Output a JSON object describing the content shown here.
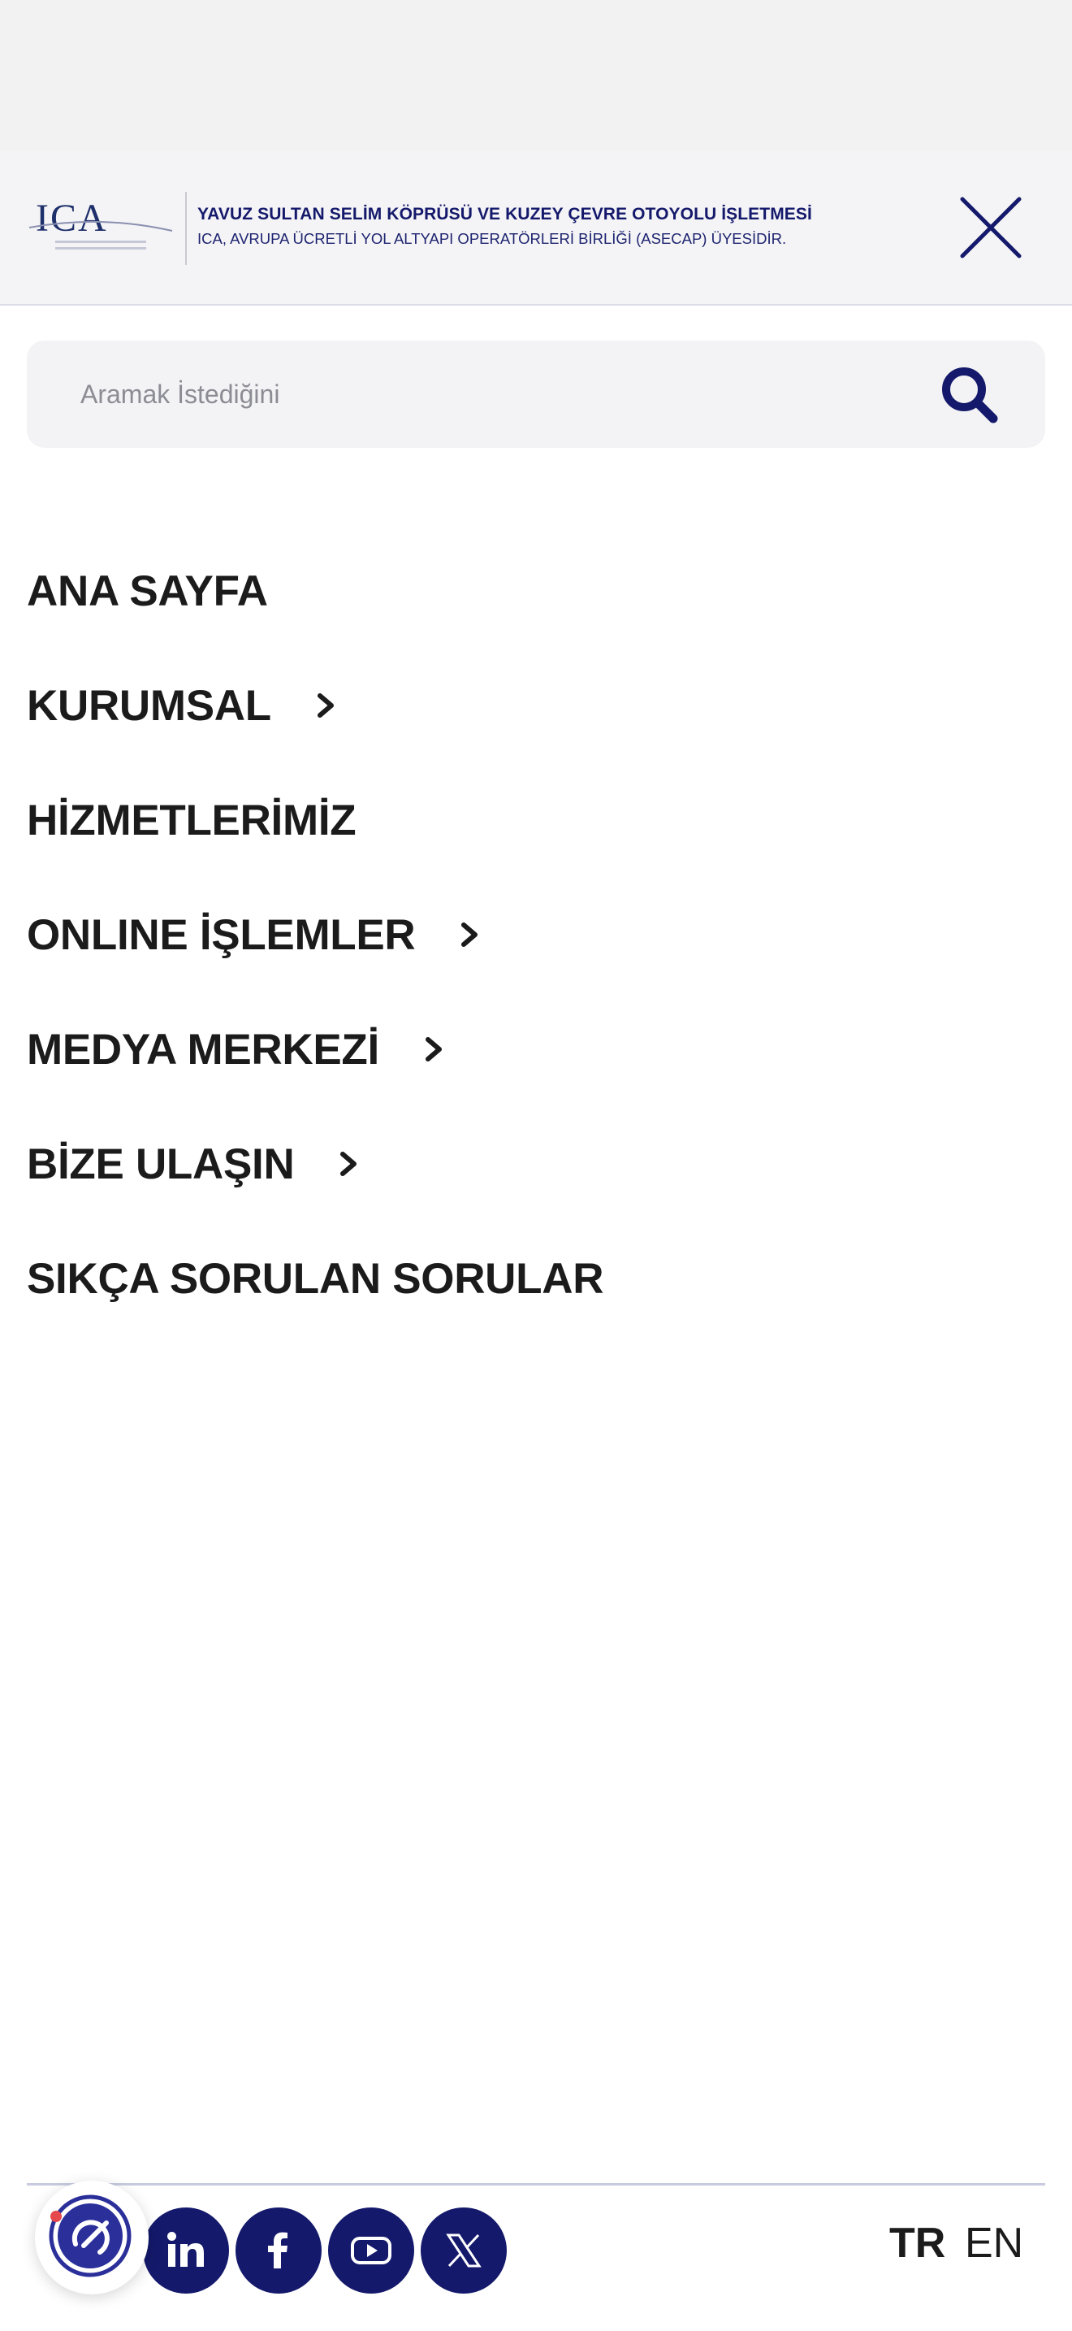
{
  "header": {
    "title": "YAVUZ SULTAN SELİM KÖPRÜSÜ VE KUZEY ÇEVRE OTOYOLU İŞLETMESİ",
    "subtitle": "ICA, AVRUPA ÜCRETLİ YOL ALTYAPI OPERATÖRLERİ BİRLİĞİ (ASECAP) ÜYESİDİR.",
    "logo_text": "ICA",
    "close_icon": "close-icon"
  },
  "search": {
    "placeholder": "Aramak İstediğini",
    "value": "",
    "icon": "search-icon"
  },
  "menu": {
    "items": [
      {
        "label": "ANA SAYFA",
        "has_submenu": false
      },
      {
        "label": "KURUMSAL",
        "has_submenu": true
      },
      {
        "label": "HİZMETLERİMİZ",
        "has_submenu": false
      },
      {
        "label": "ONLINE İŞLEMLER",
        "has_submenu": true
      },
      {
        "label": "MEDYA MERKEZİ",
        "has_submenu": true
      },
      {
        "label": "BİZE ULAŞIN",
        "has_submenu": true
      },
      {
        "label": "SIKÇA SORULAN SORULAR",
        "has_submenu": false
      }
    ]
  },
  "social": [
    {
      "icon": "linkedin-icon"
    },
    {
      "icon": "facebook-icon"
    },
    {
      "icon": "youtube-icon"
    },
    {
      "icon": "x-icon"
    }
  ],
  "accessibility_widget": {
    "icon": "accessibility-icon"
  },
  "language": {
    "options": [
      "TR",
      "EN"
    ],
    "selected": "TR"
  },
  "colors": {
    "brand": "#14196b",
    "text": "#1b1b1b",
    "header_bg": "#f4f4f6",
    "search_bg": "#f3f3f5"
  }
}
